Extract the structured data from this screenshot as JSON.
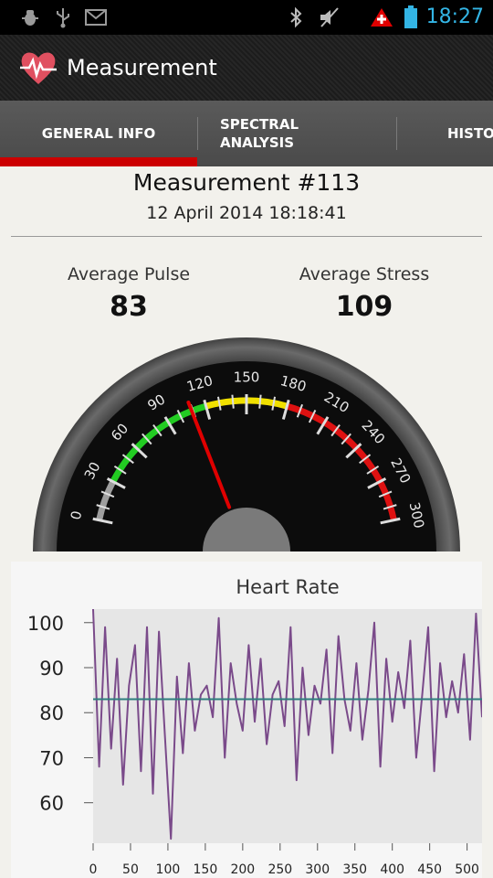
{
  "status_bar": {
    "time": "18:27",
    "left_icons": [
      "bug-icon",
      "usb-icon",
      "mail-icon"
    ],
    "right_icons": [
      "bluetooth-icon",
      "volume-muted-icon",
      "warning-icon",
      "battery-icon"
    ]
  },
  "action_bar": {
    "title": "Measurement",
    "logo": "heart-pulse-icon"
  },
  "tabs": [
    {
      "line1": "GENERAL INFO",
      "line2": "",
      "selected": true
    },
    {
      "line1": "SPECTRAL",
      "line2": "ANALYSIS",
      "selected": false
    },
    {
      "line1": "HISTO",
      "line2": "",
      "selected": false
    }
  ],
  "measurement": {
    "title": "Measurement #113",
    "date": "12 April 2014 18:18:41"
  },
  "stats": {
    "pulse_label": "Average Pulse",
    "pulse_value": "83",
    "stress_label": "Average Stress",
    "stress_value": "109"
  },
  "gauge": {
    "min": 0,
    "max": 300,
    "value": 109,
    "tick_labels": [
      "0",
      "30",
      "60",
      "90",
      "120",
      "150",
      "180",
      "210",
      "240",
      "270",
      "300"
    ],
    "bands": [
      {
        "from": 0,
        "to": 30,
        "color": "#9e9e9e"
      },
      {
        "from": 30,
        "to": 120,
        "color": "#22cc22"
      },
      {
        "from": 120,
        "to": 180,
        "color": "#f0e000"
      },
      {
        "from": 180,
        "to": 300,
        "color": "#dd1111"
      }
    ]
  },
  "chart_data": {
    "type": "line",
    "title": "Heart Rate",
    "xlabel": "",
    "ylabel": "",
    "xlim": [
      0,
      520
    ],
    "ylim": [
      51,
      103
    ],
    "x_ticks": [
      "0",
      "50",
      "100",
      "150",
      "200",
      "250",
      "300",
      "350",
      "400",
      "450",
      "500"
    ],
    "y_ticks": [
      "100",
      "90",
      "80",
      "70",
      "60"
    ],
    "average": 83,
    "series_color": "#7a4a8a",
    "average_color": "#2e7d7d",
    "x": [
      0,
      8,
      16,
      24,
      32,
      40,
      48,
      56,
      64,
      72,
      80,
      88,
      96,
      104,
      112,
      120,
      128,
      136,
      144,
      152,
      160,
      168,
      176,
      184,
      192,
      200,
      208,
      216,
      224,
      232,
      240,
      248,
      256,
      264,
      272,
      280,
      288,
      296,
      304,
      312,
      320,
      328,
      336,
      344,
      352,
      360,
      368,
      376,
      384,
      392,
      400,
      408,
      416,
      424,
      432,
      440,
      448,
      456,
      464,
      472,
      480,
      488,
      496,
      504,
      512,
      520
    ],
    "values": [
      103,
      68,
      99,
      72,
      92,
      64,
      86,
      95,
      67,
      99,
      62,
      98,
      75,
      52,
      88,
      71,
      91,
      76,
      84,
      86,
      79,
      101,
      70,
      91,
      82,
      76,
      95,
      78,
      92,
      73,
      84,
      87,
      77,
      99,
      65,
      90,
      75,
      86,
      82,
      94,
      71,
      97,
      83,
      76,
      91,
      74,
      85,
      100,
      68,
      92,
      78,
      89,
      81,
      96,
      70,
      84,
      99,
      67,
      91,
      79,
      87,
      80,
      93,
      74,
      102,
      79
    ]
  }
}
